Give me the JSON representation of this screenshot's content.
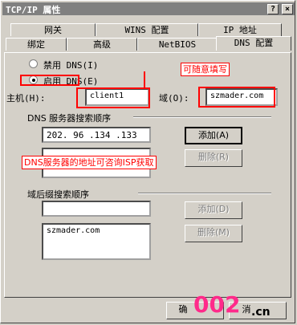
{
  "window": {
    "title": "TCP/IP 属性",
    "help_btn": "?",
    "close_btn": "×"
  },
  "tabs_row1": [
    "网关",
    "WINS 配置",
    "IP 地址"
  ],
  "tabs_row2": [
    "绑定",
    "高级",
    "NetBIOS",
    "DNS 配置"
  ],
  "dns": {
    "disable_label": "禁用 DNS(I)",
    "enable_label": "启用 DNS(E)",
    "host_label": "主机(H):",
    "host_value": "client1",
    "domain_label": "域(O):",
    "domain_value": "szmader.com",
    "server_order_label": "DNS 服务器搜索顺序",
    "server_input_value": "202. 96 .134 .133",
    "add_button": "添加(A)",
    "delete_button": "删除(R)",
    "suffix_order_label": "域后缀搜索顺序",
    "suffix_add_button": "添加(D)",
    "suffix_delete_button": "删除(M)",
    "suffix_list": [
      "szmader.com"
    ]
  },
  "annotations": {
    "fill_in_any": "可随意填写",
    "dns_note": "DNS服务器的地址可咨询ISP获取"
  },
  "footer": {
    "ok_button": "确",
    "cancel_partial": "消"
  },
  "watermark": {
    "digits": "002",
    "tld": ".cn"
  }
}
